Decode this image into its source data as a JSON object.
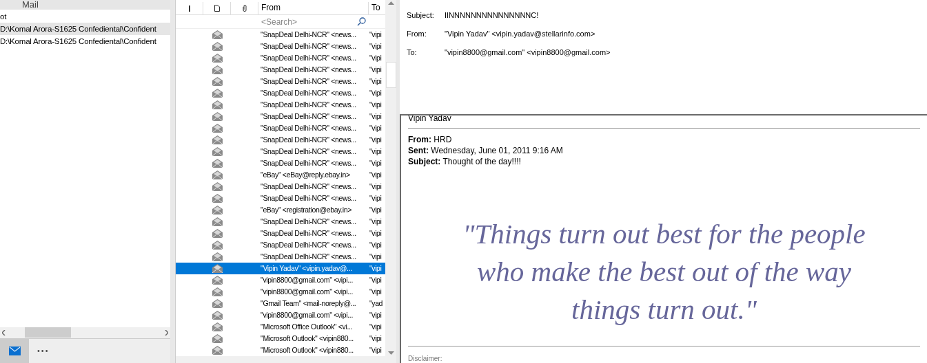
{
  "sidebar": {
    "title": "Mail",
    "items": [
      {
        "label": "ot",
        "selected": false
      },
      {
        "label": "D:\\Komal Arora-S1625 Confediental\\Confident",
        "selected": true
      },
      {
        "label": "D:\\Komal Arora-S1625 Confediental\\Confident",
        "selected": false
      }
    ],
    "more": "•••"
  },
  "message_list": {
    "columns": [
      "From",
      "To"
    ],
    "search_placeholder": "<Search>",
    "rows": [
      {
        "from": "\"SnapDeal Delhi-NCR\" <news...",
        "to": "\"vipi",
        "selected": false
      },
      {
        "from": "\"SnapDeal Delhi-NCR\" <news...",
        "to": "\"vipi",
        "selected": false
      },
      {
        "from": "\"SnapDeal Delhi-NCR\" <news...",
        "to": "\"vipi",
        "selected": false
      },
      {
        "from": "\"SnapDeal Delhi-NCR\" <news...",
        "to": "\"vipi",
        "selected": false
      },
      {
        "from": "\"SnapDeal Delhi-NCR\" <news...",
        "to": "\"vipi",
        "selected": false
      },
      {
        "from": "\"SnapDeal Delhi-NCR\" <news...",
        "to": "\"vipi",
        "selected": false
      },
      {
        "from": "\"SnapDeal Delhi-NCR\" <news...",
        "to": "\"vipi",
        "selected": false
      },
      {
        "from": "\"SnapDeal Delhi-NCR\" <news...",
        "to": "\"vipi",
        "selected": false
      },
      {
        "from": "\"SnapDeal Delhi-NCR\" <news...",
        "to": "\"vipi",
        "selected": false
      },
      {
        "from": "\"SnapDeal Delhi-NCR\" <news...",
        "to": "\"vipi",
        "selected": false
      },
      {
        "from": "\"SnapDeal Delhi-NCR\" <news...",
        "to": "\"vipi",
        "selected": false
      },
      {
        "from": "\"SnapDeal Delhi-NCR\" <news...",
        "to": "\"vipi",
        "selected": false
      },
      {
        "from": "\"eBay\" <eBay@reply.ebay.in>",
        "to": "\"vipi",
        "selected": false
      },
      {
        "from": "\"SnapDeal Delhi-NCR\" <news...",
        "to": "\"vipi",
        "selected": false
      },
      {
        "from": "\"SnapDeal Delhi-NCR\" <news...",
        "to": "\"vipi",
        "selected": false
      },
      {
        "from": "\"eBay\" <registration@ebay.in>",
        "to": "\"vipi",
        "selected": false
      },
      {
        "from": "\"SnapDeal Delhi-NCR\" <news...",
        "to": "\"vipi",
        "selected": false
      },
      {
        "from": "\"SnapDeal Delhi-NCR\" <news...",
        "to": "\"vipi",
        "selected": false
      },
      {
        "from": "\"SnapDeal Delhi-NCR\" <news...",
        "to": "\"vipi",
        "selected": false
      },
      {
        "from": "\"SnapDeal Delhi-NCR\" <news...",
        "to": "\"vipi",
        "selected": false
      },
      {
        "from": "\"Vipin Yadav\" <vipin.yadav@...",
        "to": "\"vipi",
        "selected": true
      },
      {
        "from": "\"vipin8800@gmail.com\" <vipi...",
        "to": "\"vipi",
        "selected": false
      },
      {
        "from": "\"vipin8800@gmail.com\" <vipi...",
        "to": "\"vipi",
        "selected": false
      },
      {
        "from": "\"Gmail Team\" <mail-noreply@...",
        "to": "\"yad",
        "selected": false
      },
      {
        "from": "\"vipin8800@gmail.com\" <vipi...",
        "to": "\"vipi",
        "selected": false
      },
      {
        "from": "\"Microsoft Office Outlook\" <vi...",
        "to": "\"vipi",
        "selected": false
      },
      {
        "from": "\"Microsoft Outlook\" <vipin880...",
        "to": "\"vipi",
        "selected": false
      },
      {
        "from": "\"Microsoft Outlook\" <vipin880...",
        "to": "\"vipi",
        "selected": false
      }
    ]
  },
  "reading_pane": {
    "headers": [
      {
        "label": "Subject:",
        "value": "IINNNNNNNNNNNNNNNC!"
      },
      {
        "label": "From:",
        "value": "\"Vipin Yadav\" <vipin.yadav@stellarinfo.com>"
      },
      {
        "label": "To:",
        "value": "\"vipin8800@gmail.com\" <vipin8800@gmail.com>"
      }
    ],
    "body": {
      "sender": "Vipin Yadav",
      "fields": [
        "**From:** HRD",
        "**Sent:** Wednesday, June 01, 2011 9:16 AM",
        "**Subject:** Thought of the day!!!!"
      ],
      "quote": "\"Things turn out best for the people who make the best out of the way things turn out.\"",
      "footer": "Disclaimer:"
    }
  }
}
